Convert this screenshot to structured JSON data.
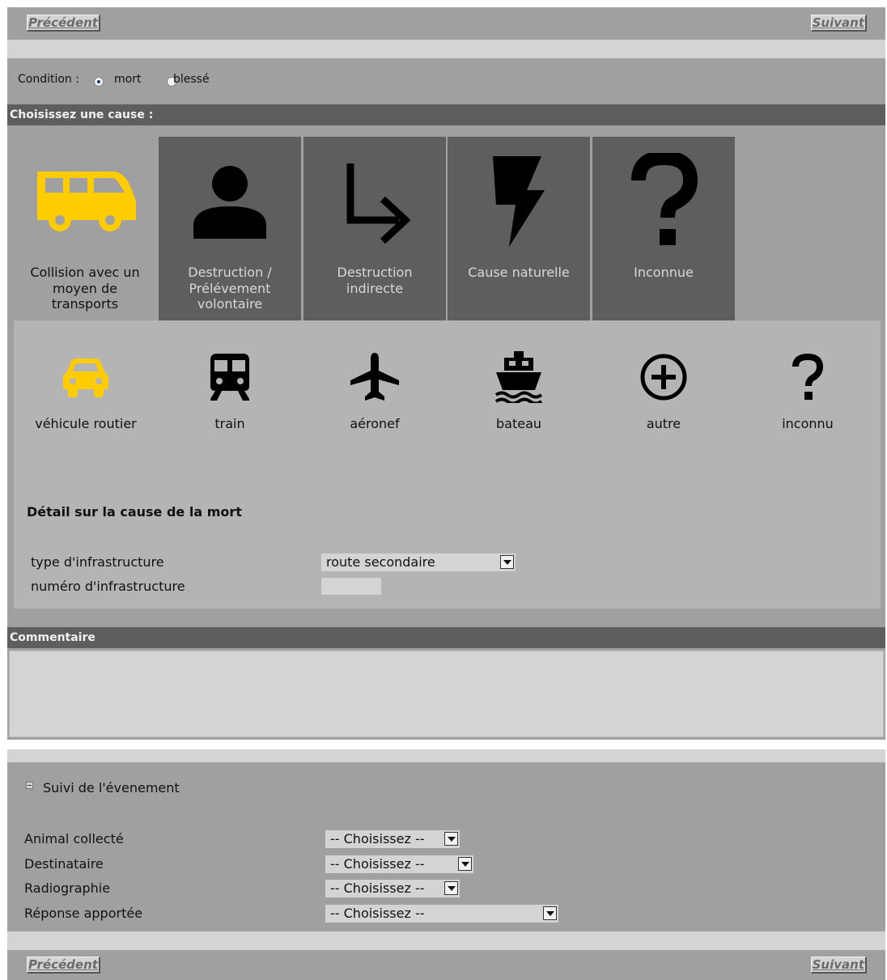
{
  "nav": {
    "prev_label": "Précédent",
    "next_label": "Suivant"
  },
  "condition": {
    "label": "Condition :",
    "options": [
      {
        "label": "mort",
        "checked": true
      },
      {
        "label": "blessé",
        "checked": false
      }
    ]
  },
  "cause_header": "Choisissez une cause :",
  "causes": [
    {
      "label": "Collision avec un moyen de transports",
      "icon": "bus-icon",
      "active": true
    },
    {
      "label": "Destruction / Prélévement volontaire",
      "icon": "person-icon",
      "active": false
    },
    {
      "label": "Destruction indirecte",
      "icon": "arrow-turn-icon",
      "active": false
    },
    {
      "label": "Cause naturelle",
      "icon": "lightning-icon",
      "active": false
    },
    {
      "label": "Inconnue",
      "icon": "question-icon",
      "active": false
    }
  ],
  "transports": [
    {
      "label": "véhicule routier",
      "icon": "car-icon",
      "active": true
    },
    {
      "label": "train",
      "icon": "train-icon",
      "active": false
    },
    {
      "label": "aéronef",
      "icon": "airplane-icon",
      "active": false
    },
    {
      "label": "bateau",
      "icon": "boat-icon",
      "active": false
    },
    {
      "label": "autre",
      "icon": "plus-circle-icon",
      "active": false
    },
    {
      "label": "inconnu",
      "icon": "question-icon",
      "active": false
    }
  ],
  "detail": {
    "title": "Détail sur la cause de la mort",
    "infra_type_label": "type d'infrastructure",
    "infra_type_value": "route secondaire",
    "infra_num_label": "numéro d'infrastructure",
    "infra_num_value": ""
  },
  "comment": {
    "header": "Commentaire",
    "value": ""
  },
  "followup": {
    "title": "Suivi de l'évenement",
    "fields": [
      {
        "label": "Animal collecté",
        "value": "-- Choisissez --"
      },
      {
        "label": "Destinataire",
        "value": "-- Choisissez --"
      },
      {
        "label": "Radiographie",
        "value": "-- Choisissez --"
      },
      {
        "label": "Réponse apportée",
        "value": "-- Choisissez --"
      }
    ]
  },
  "colors": {
    "accent_yellow": "#ffcc00",
    "header_dark": "#5e5e5e",
    "panel_gray": "#a0a0a0",
    "light_gray": "#d4d4d4"
  }
}
